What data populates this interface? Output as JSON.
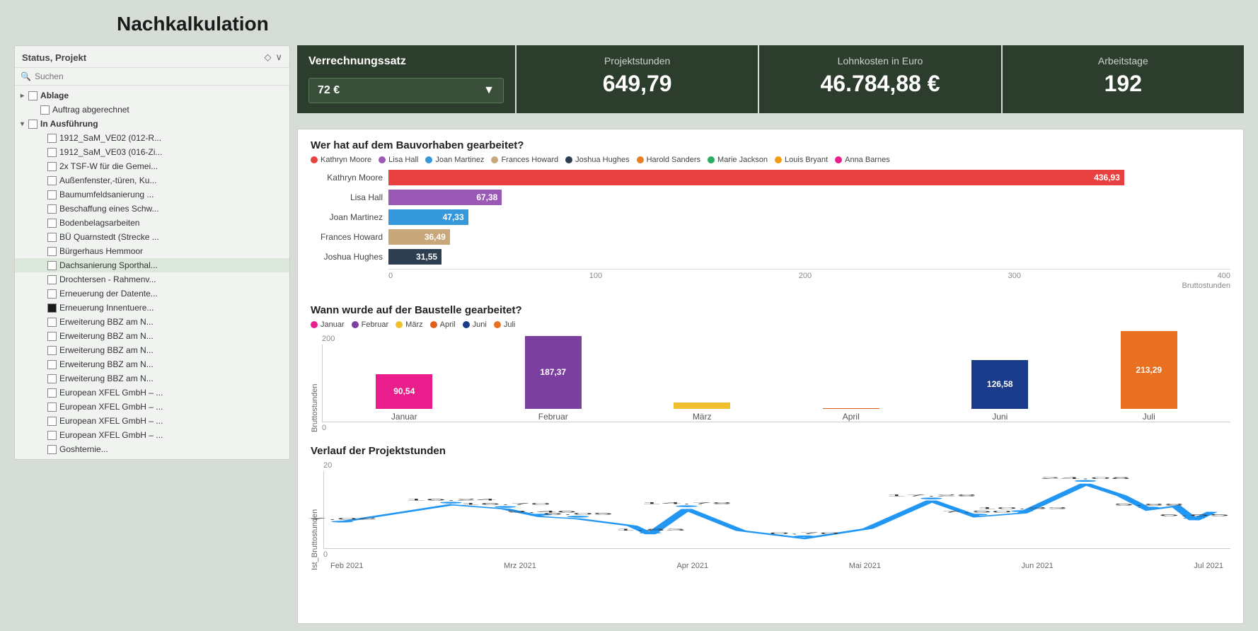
{
  "page": {
    "title": "Nachkalkulation"
  },
  "verrechnungssatz": {
    "label": "Verrechnungssatz",
    "value": "72 €",
    "dropdown_arrow": "▼"
  },
  "kpis": [
    {
      "label": "Projektstunden",
      "value": "649,79"
    },
    {
      "label": "Lohnkosten in Euro",
      "value": "46.784,88 €"
    },
    {
      "label": "Arbeitstage",
      "value": "192"
    }
  ],
  "sidebar": {
    "header_label": "Status, Projekt",
    "search_placeholder": "Suchen",
    "items": [
      {
        "level": 0,
        "label": "Ablage",
        "has_checkbox": true,
        "checked": false,
        "has_chevron": true
      },
      {
        "level": 1,
        "label": "Auftrag abgerechnet",
        "has_checkbox": true,
        "checked": false,
        "has_chevron": false
      },
      {
        "level": 0,
        "label": "In Ausführung",
        "has_checkbox": true,
        "checked": false,
        "has_chevron": true,
        "expanded": true
      },
      {
        "level": 2,
        "label": "1912_SaM_VE02 (012-R...",
        "has_checkbox": true,
        "checked": false
      },
      {
        "level": 2,
        "label": "1912_SaM_VE03 (016-Zi...",
        "has_checkbox": true,
        "checked": false
      },
      {
        "level": 2,
        "label": "2x TSF-W für die Gemei...",
        "has_checkbox": true,
        "checked": false
      },
      {
        "level": 2,
        "label": "Außenfenster,-türen, Ku...",
        "has_checkbox": true,
        "checked": false
      },
      {
        "level": 2,
        "label": "Baumumfeldsanierung ...",
        "has_checkbox": true,
        "checked": false
      },
      {
        "level": 2,
        "label": "Beschaffung eines Schw...",
        "has_checkbox": true,
        "checked": false
      },
      {
        "level": 2,
        "label": "Bodenbelagsarbeiten",
        "has_checkbox": true,
        "checked": false
      },
      {
        "level": 2,
        "label": "BÜ Quarnstedt (Strecke ...",
        "has_checkbox": true,
        "checked": false
      },
      {
        "level": 2,
        "label": "Bürgerhaus Hemmoor",
        "has_checkbox": true,
        "checked": false
      },
      {
        "level": 2,
        "label": "Dachsanierung Sporthal...",
        "has_checkbox": true,
        "checked": false,
        "active": true
      },
      {
        "level": 2,
        "label": "Drochtersen - Rahmenv...",
        "has_checkbox": true,
        "checked": false
      },
      {
        "level": 2,
        "label": "Erneuerung der Datente...",
        "has_checkbox": true,
        "checked": false
      },
      {
        "level": 2,
        "label": "Erneuerung Innentuere...",
        "has_checkbox": true,
        "checked": true,
        "filled": true
      },
      {
        "level": 2,
        "label": "Erweiterung BBZ am N...",
        "has_checkbox": true,
        "checked": false
      },
      {
        "level": 2,
        "label": "Erweiterung BBZ am N...",
        "has_checkbox": true,
        "checked": false
      },
      {
        "level": 2,
        "label": "Erweiterung BBZ am N...",
        "has_checkbox": true,
        "checked": false
      },
      {
        "level": 2,
        "label": "Erweiterung BBZ am N...",
        "has_checkbox": true,
        "checked": false
      },
      {
        "level": 2,
        "label": "Erweiterung BBZ am N...",
        "has_checkbox": true,
        "checked": false
      },
      {
        "level": 2,
        "label": "European XFEL GmbH – ...",
        "has_checkbox": true,
        "checked": false
      },
      {
        "level": 2,
        "label": "European XFEL GmbH – ...",
        "has_checkbox": true,
        "checked": false
      },
      {
        "level": 2,
        "label": "European XFEL GmbH – ...",
        "has_checkbox": true,
        "checked": false
      },
      {
        "level": 2,
        "label": "European XFEL GmbH – ...",
        "has_checkbox": true,
        "checked": false
      },
      {
        "level": 2,
        "label": "Goshternie...",
        "has_checkbox": true,
        "checked": false
      }
    ]
  },
  "chart1": {
    "title": "Wer hat auf dem Bauvorhaben gearbeitet?",
    "axis_label": "Bruttostunden",
    "legend": [
      {
        "name": "Kathryn Moore",
        "color": "#e84040"
      },
      {
        "name": "Lisa Hall",
        "color": "#9b59b6"
      },
      {
        "name": "Joan Martinez",
        "color": "#3498db"
      },
      {
        "name": "Frances Howard",
        "color": "#c8a87a"
      },
      {
        "name": "Joshua Hughes",
        "color": "#2c3e50"
      },
      {
        "name": "Harold Sanders",
        "color": "#e67e22"
      },
      {
        "name": "Marie Jackson",
        "color": "#27ae60"
      },
      {
        "name": "Louis Bryant",
        "color": "#f39c12"
      },
      {
        "name": "Anna Barnes",
        "color": "#e91e8c"
      }
    ],
    "bars": [
      {
        "label": "Kathryn Moore",
        "value": 436.93,
        "display": "436,93",
        "color": "#e84040",
        "max": 500
      },
      {
        "label": "Lisa Hall",
        "value": 67.38,
        "display": "67,38",
        "color": "#9b59b6",
        "max": 500
      },
      {
        "label": "Joan Martinez",
        "value": 47.33,
        "display": "47,33",
        "color": "#3498db",
        "max": 500
      },
      {
        "label": "Frances Howard",
        "value": 36.49,
        "display": "36,49",
        "color": "#c8a87a",
        "max": 500
      },
      {
        "label": "Joshua Hughes",
        "value": 31.55,
        "display": "31,55",
        "color": "#2c3e50",
        "max": 500
      }
    ],
    "axis_ticks": [
      "0",
      "100",
      "200",
      "300",
      "400"
    ]
  },
  "chart2": {
    "title": "Wann wurde auf der Baustelle gearbeitet?",
    "y_label": "Bruttostunden",
    "y_ticks": [
      "200",
      "0"
    ],
    "legend": [
      {
        "name": "Januar",
        "color": "#e91e8c"
      },
      {
        "name": "Februar",
        "color": "#7b3fa0"
      },
      {
        "name": "März",
        "color": "#f0c030"
      },
      {
        "name": "April",
        "color": "#e06020"
      },
      {
        "name": "Juni",
        "color": "#1a3a8a"
      },
      {
        "name": "Juli",
        "color": "#e87020"
      }
    ],
    "bars": [
      {
        "label": "Januar",
        "value": 90.54,
        "display": "90,54",
        "color": "#e91e8c",
        "height_pct": 45
      },
      {
        "label": "Februar",
        "value": 187.37,
        "display": "187,37",
        "color": "#7b3fa0",
        "height_pct": 94
      },
      {
        "label": "März",
        "value": 0,
        "display": "",
        "color": "#f0c030",
        "height_pct": 8
      },
      {
        "label": "April",
        "value": 0,
        "display": "",
        "color": "#e06020",
        "height_pct": 0
      },
      {
        "label": "Juni",
        "value": 126.58,
        "display": "126,58",
        "color": "#1a3a8a",
        "height_pct": 63
      },
      {
        "label": "Juli",
        "value": 213.29,
        "display": "213,29",
        "color": "#e87020",
        "height_pct": 100
      }
    ]
  },
  "chart3": {
    "title": "Verlauf der Projektstunden",
    "y_label": "Ist_Bruttostunden",
    "y_tick": "20",
    "y_tick_zero": "0",
    "x_labels": [
      "Feb 2021",
      "Mrz 2021",
      "Apr 2021",
      "Mai 2021",
      "Jun 2021",
      "Jul 2021"
    ],
    "data_labels": [
      {
        "x_pct": 2,
        "y_pct": 72,
        "label": "7,02"
      },
      {
        "x_pct": 14,
        "y_pct": 48,
        "label": "16,24"
      },
      {
        "x_pct": 20,
        "y_pct": 54,
        "label": "16,70"
      },
      {
        "x_pct": 24,
        "y_pct": 65,
        "label": "9,46"
      },
      {
        "x_pct": 28,
        "y_pct": 68,
        "label": "6,05"
      },
      {
        "x_pct": 36,
        "y_pct": 90,
        "label": "1,83"
      },
      {
        "x_pct": 40,
        "y_pct": 54,
        "label": "14,78"
      },
      {
        "x_pct": 53,
        "y_pct": 96,
        "label": "0,70"
      },
      {
        "x_pct": 67,
        "y_pct": 42,
        "label": "17,28"
      },
      {
        "x_pct": 72,
        "y_pct": 65,
        "label": "7,50"
      },
      {
        "x_pct": 77,
        "y_pct": 60,
        "label": "10,33"
      },
      {
        "x_pct": 84,
        "y_pct": 18,
        "label": "24,08"
      },
      {
        "x_pct": 91,
        "y_pct": 55,
        "label": "5,88"
      },
      {
        "x_pct": 96,
        "y_pct": 70,
        "label": "6,65"
      }
    ]
  }
}
